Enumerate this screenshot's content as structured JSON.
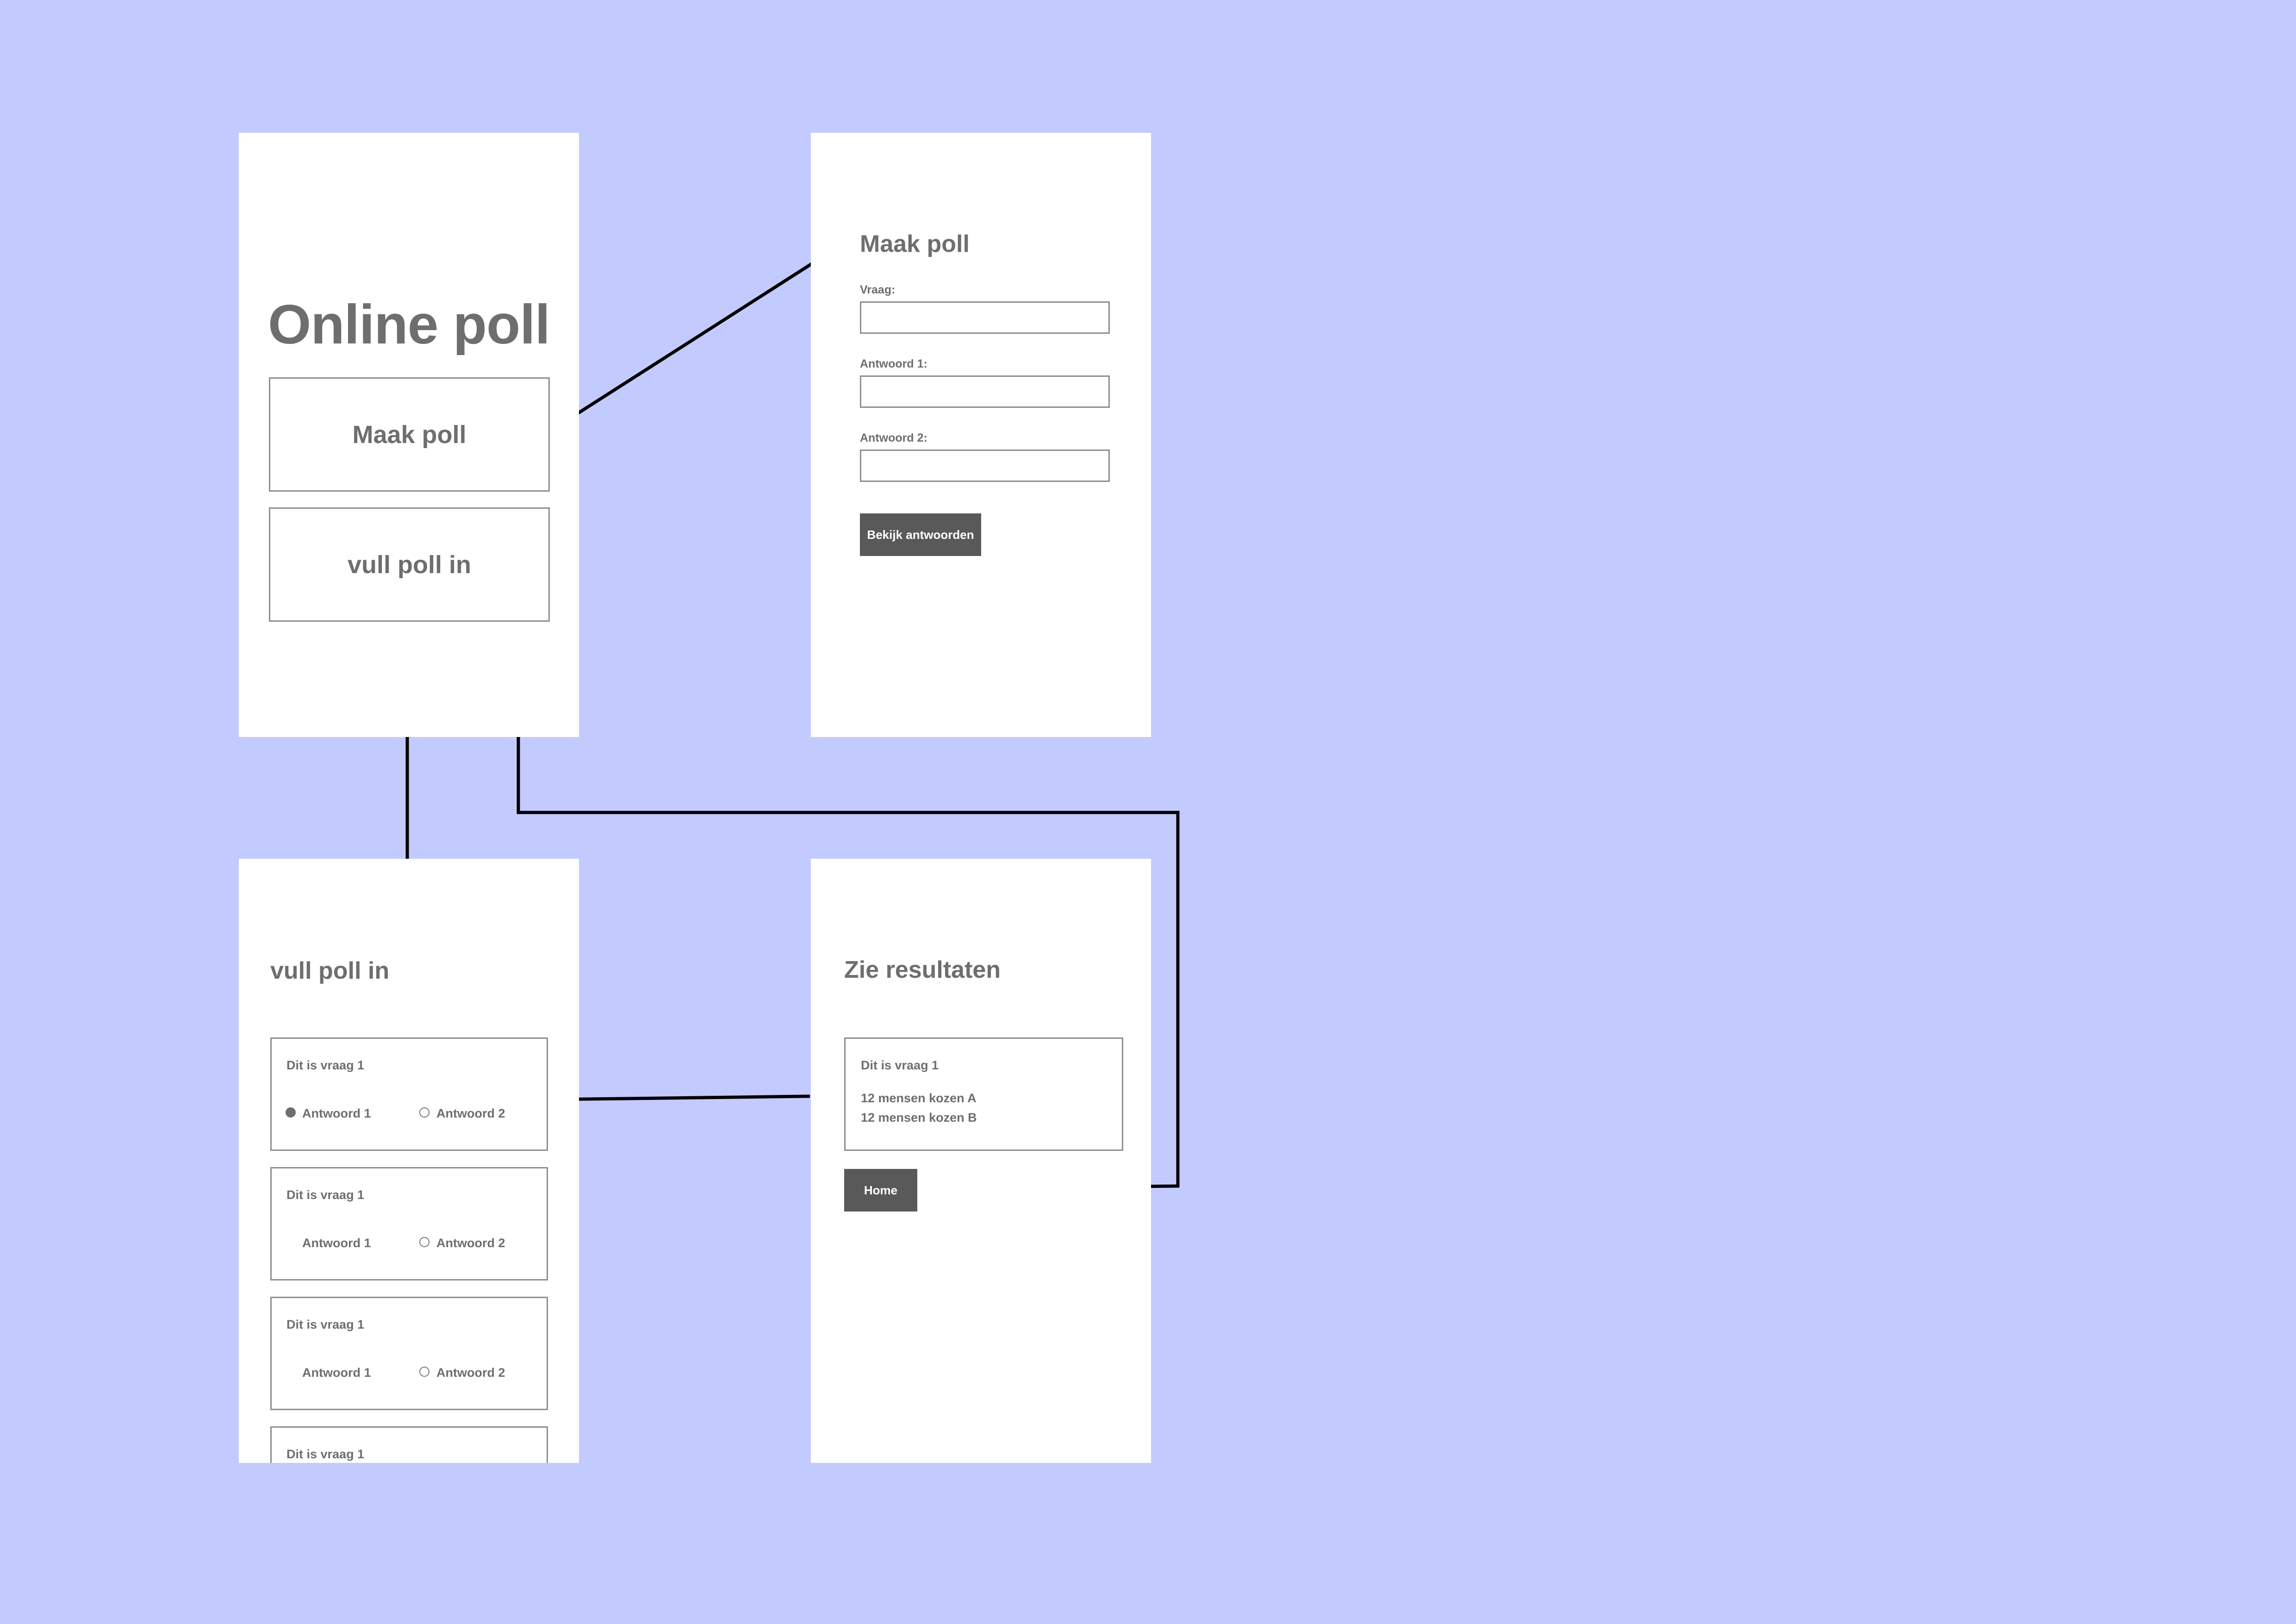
{
  "home": {
    "title": "Online poll",
    "make_poll_button": "Maak poll",
    "fill_poll_button": "vull poll in"
  },
  "make_poll": {
    "title": "Maak poll",
    "question_label": "Vraag:",
    "answer1_label": "Antwoord 1:",
    "answer2_label": "Antwoord 2:",
    "submit_button": "Bekijk antwoorden"
  },
  "fill_poll": {
    "title": "vull poll in",
    "cards": [
      {
        "question": "Dit is vraag 1",
        "answer1": "Antwoord 1",
        "answer2": "Antwoord 2"
      },
      {
        "question": "Dit is vraag 1",
        "answer1": "Antwoord 1",
        "answer2": "Antwoord 2"
      },
      {
        "question": "Dit is vraag 1",
        "answer1": "Antwoord 1",
        "answer2": "Antwoord 2"
      },
      {
        "question": "Dit is vraag 1"
      }
    ]
  },
  "results": {
    "title": "Zie resultaten",
    "question": "Dit is vraag 1",
    "line1": "12 mensen kozen A",
    "line2": "12 mensen kozen B",
    "home_button": "Home"
  }
}
